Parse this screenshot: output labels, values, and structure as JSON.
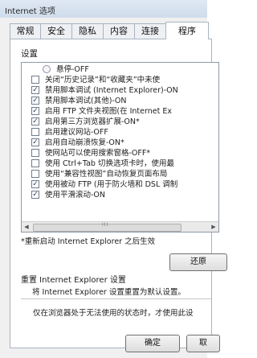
{
  "window": {
    "title": "Internet 选项"
  },
  "tabs": [
    {
      "label": "常规"
    },
    {
      "label": "安全"
    },
    {
      "label": "隐私"
    },
    {
      "label": "内容"
    },
    {
      "label": "连接"
    },
    {
      "label": "程序"
    }
  ],
  "settings": {
    "label": "设置",
    "items": [
      {
        "type": "radio",
        "label": "悬停-OFF"
      },
      {
        "type": "checkbox",
        "checked": false,
        "label": "关闭“历史记录”和“收藏夹”中未使"
      },
      {
        "type": "checkbox",
        "checked": true,
        "label": "禁用脚本调试 (Internet Explorer)-ON"
      },
      {
        "type": "checkbox",
        "checked": true,
        "label": "禁用脚本调试(其他)-ON"
      },
      {
        "type": "checkbox",
        "checked": true,
        "label": "启用 FTP 文件夹视图(在 Internet Ex"
      },
      {
        "type": "checkbox",
        "checked": true,
        "label": "启用第三方浏览器扩展-ON*"
      },
      {
        "type": "checkbox",
        "checked": false,
        "label": "启用建议网站-OFF"
      },
      {
        "type": "checkbox",
        "checked": true,
        "label": "启用自动崩溃恢复-ON*"
      },
      {
        "type": "checkbox",
        "checked": false,
        "label": "使网站可以使用搜索窗格-OFF*"
      },
      {
        "type": "checkbox",
        "checked": false,
        "label": "使用 Ctrl+Tab 切换选项卡时，使用最"
      },
      {
        "type": "checkbox",
        "checked": false,
        "label": "使用“兼容性视图”自动恢复页面布局"
      },
      {
        "type": "checkbox",
        "checked": true,
        "label": "使用被动 FTP (用于防火墙和 DSL 调制"
      },
      {
        "type": "checkbox",
        "checked": true,
        "label": "使用平滑滚动-ON"
      }
    ],
    "scroll_grip": "III"
  },
  "note": "*重新启动 Internet Explorer 之后生效",
  "restore_button": "还原",
  "reset": {
    "heading": "重置 Internet Explorer 设置",
    "description": "将 Internet Explorer 设置重置为默认设置。",
    "warning": "仅在浏览器处于无法使用的状态时，才使用此设"
  },
  "footer": {
    "ok": "确定",
    "cancel": "取"
  }
}
